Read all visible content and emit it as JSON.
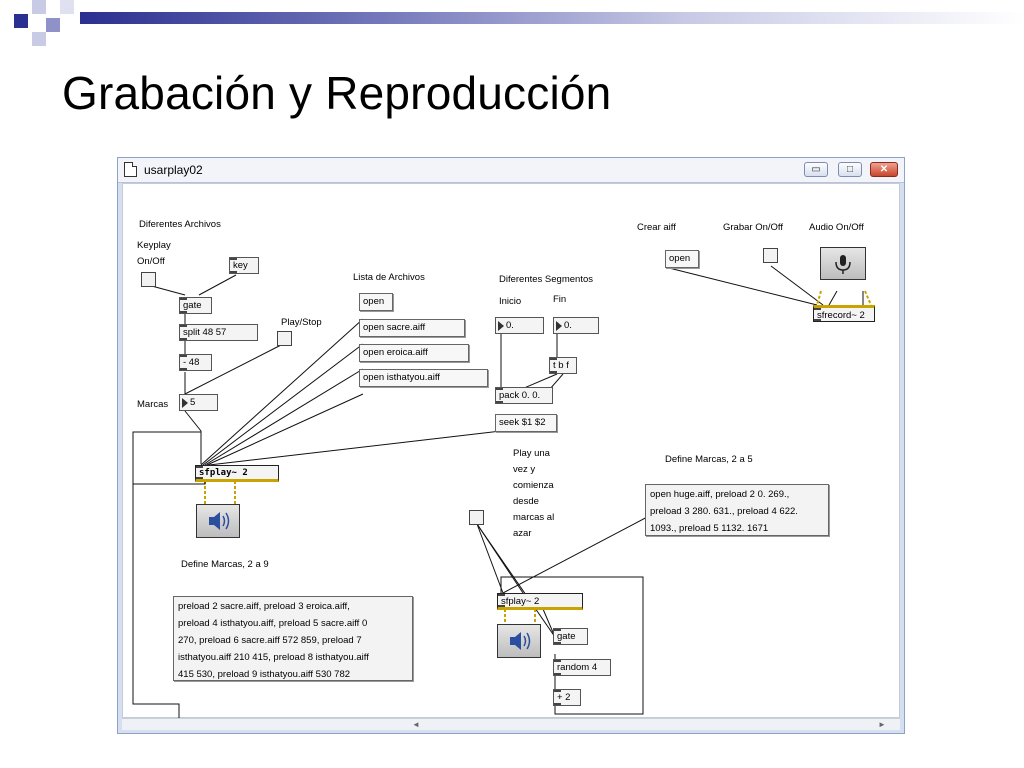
{
  "slide": {
    "title": "Grabación y Reproducción"
  },
  "window": {
    "title": "usarplay02",
    "buttons": {
      "minimize": "▭",
      "maximize": "□",
      "close": "✕"
    }
  },
  "labels": {
    "diferentes_archivos": "Diferentes Archivos",
    "keyplay_1": "Keyplay",
    "keyplay_2": "On/Off",
    "play_stop": "Play/Stop",
    "lista_archivos": "Lista de Archivos",
    "diferentes_segmentos": "Diferentes Segmentos",
    "inicio": "Inicio",
    "fin": "Fin",
    "crear_aiff": "Crear aiff",
    "grabar_onoff": "Grabar On/Off",
    "audio_onoff": "Audio On/Off",
    "marcas": "Marcas",
    "define_marcas_2_9": "Define Marcas, 2 a 9",
    "define_marcas_2_5": "Define Marcas, 2 a 5",
    "play_una_1": "Play una",
    "play_una_2": "vez y",
    "play_una_3": "comienza",
    "play_una_4": "desde",
    "play_una_5": "marcas al",
    "play_una_6": "azar"
  },
  "objects": {
    "key": "key",
    "gate1": "gate",
    "split": "split 48 57",
    "minus48": "- 48",
    "marcas_num": "5",
    "sfplay1": "sfplay~ 2",
    "pack": "pack 0. 0.",
    "seek": "seek $1 $2",
    "tbf": "t b f",
    "inicio_num": "0.",
    "fin_num": "0.",
    "sfrecord": "sfrecord~ 2",
    "sfplay2": "sfplay~ 2",
    "gate2": "gate",
    "random4": "random 4",
    "plus2": "+ 2"
  },
  "messages": {
    "open_files": "open",
    "open_sacre": "open sacre.aiff",
    "open_eroica": "open eroica.aiff",
    "open_isthatyou": "open isthatyou.aiff",
    "open_rec": "open"
  },
  "preload_box_1": [
    "preload 2 sacre.aiff, preload 3 eroica.aiff,",
    "preload 4 isthatyou.aiff, preload 5 sacre.aiff 0",
    "270, preload 6 sacre.aiff 572 859, preload 7",
    "isthatyou.aiff 210 415, preload 8 isthatyou.aiff",
    "415 530, preload 9 isthatyou.aiff 530 782"
  ],
  "preload_box_2": [
    "open huge.aiff, preload 2 0. 269.,",
    "preload 3 280. 631., preload 4 622.",
    "1093., preload 5 1132. 1671"
  ]
}
